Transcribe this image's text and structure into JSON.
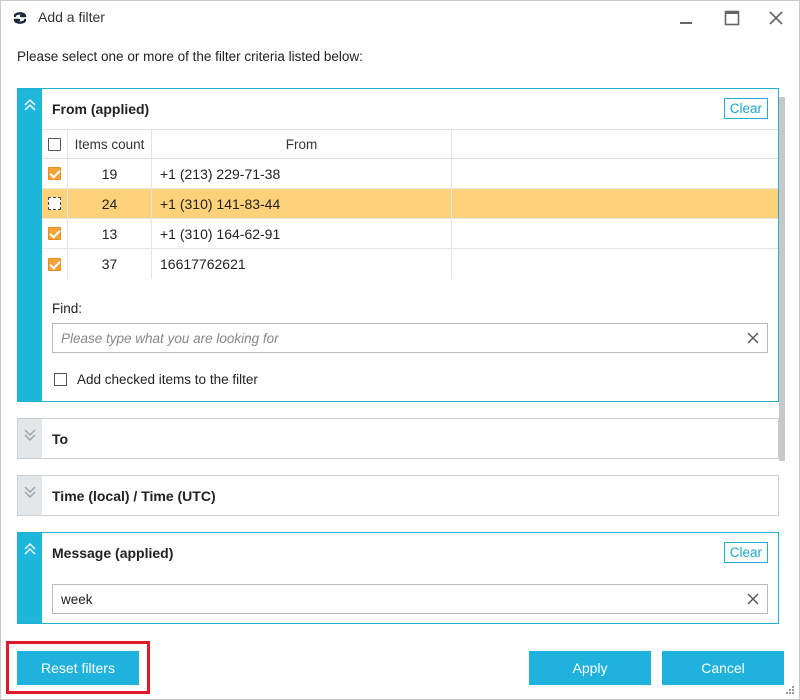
{
  "window": {
    "title": "Add a filter",
    "icon": "app-logo-icon"
  },
  "instruction": "Please select one or more of the filter criteria listed below:",
  "from_panel": {
    "title": "From  (applied)",
    "clear_label": "Clear",
    "columns": [
      "Items count",
      "From"
    ],
    "rows": [
      {
        "checked": true,
        "count": "19",
        "from": "+1 (213) 229-71-38",
        "highlighted": false
      },
      {
        "checked": false,
        "count": "24",
        "from": "+1 (310) 141-83-44",
        "highlighted": true
      },
      {
        "checked": true,
        "count": "13",
        "from": "+1 (310) 164-62-91",
        "highlighted": false
      },
      {
        "checked": true,
        "count": "37",
        "from": "16617762621",
        "highlighted": false
      }
    ],
    "find_label": "Find:",
    "find_placeholder": "Please type what you are looking for",
    "add_checked_label": "Add checked items to the filter"
  },
  "to_panel": {
    "title": "To"
  },
  "time_panel": {
    "title": "Time (local) / Time (UTC)"
  },
  "message_panel": {
    "title": "Message  (applied)",
    "clear_label": "Clear",
    "value": "week"
  },
  "footer": {
    "reset_label": "Reset filters",
    "apply_label": "Apply",
    "cancel_label": "Cancel"
  },
  "colors": {
    "accent": "#1fb2dc",
    "highlight_row": "#fdd27a",
    "checkbox_checked": "#f3a33a",
    "annotation_red": "#e1182a"
  }
}
